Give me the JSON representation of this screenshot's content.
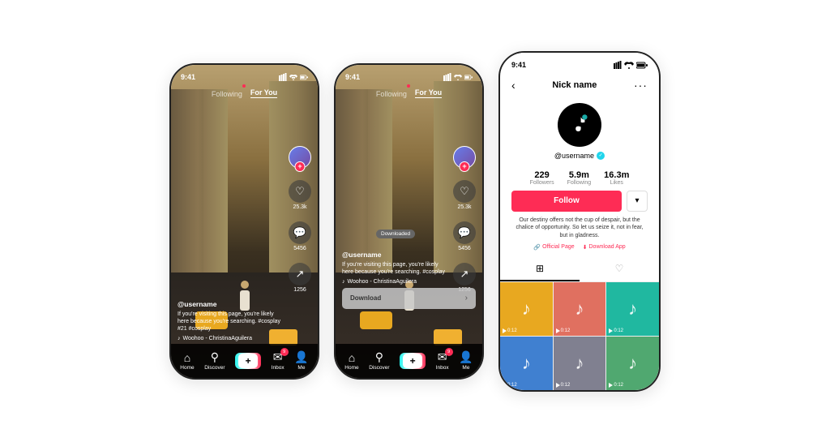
{
  "phones": {
    "phone1": {
      "time": "9:41",
      "tabs": {
        "following": "Following",
        "forYou": "For You"
      },
      "username": "@username",
      "caption": "If you're visiting this page, you're likely here because you're searching. #cosplay #21 #cosplay",
      "music": "♪ Woohoo - ChristinaAguilera",
      "likeCount": "25.3k",
      "commentCount": "5456",
      "shareCount": "1256",
      "nav": {
        "home": "Home",
        "discover": "Discover",
        "inbox": "Inbox",
        "me": "Me",
        "inboxBadge": "9"
      }
    },
    "phone2": {
      "time": "9:41",
      "tabs": {
        "following": "Following",
        "forYou": "For You"
      },
      "username": "@username",
      "caption": "If you're visiting this page, you're likely here because you're searching. #cosplay",
      "music": "♪ Woohoo - ChristinaAguilera",
      "likeCount": "25.3k",
      "commentCount": "5456",
      "shareCount": "1256",
      "downloadedBadge": "Downloaded",
      "downloadLabel": "Download",
      "nav": {
        "home": "Home",
        "discover": "Discover",
        "inbox": "Inbox",
        "me": "Me",
        "inboxBadge": "9"
      }
    },
    "phone3": {
      "time": "9:41",
      "nickname": "Nick name",
      "username": "@username",
      "stats": {
        "followers": "229",
        "followersLabel": "Followers",
        "following": "5.9m",
        "followingLabel": "Following",
        "likes": "16.3m",
        "likesLabel": "Likes"
      },
      "followBtn": "Follow",
      "bio": "Our destiny offers not the cup of despair, but the chalice of opportunity. So let us seize it, not in fear, but in gladness.",
      "officialPageLink": "Official Page",
      "downloadAppLink": "Download App",
      "gridItems": [
        {
          "duration": "0:12",
          "bg": "yellow"
        },
        {
          "duration": "0:12",
          "bg": "salmon"
        },
        {
          "duration": "0:12",
          "bg": "teal"
        },
        {
          "duration": "0:12",
          "bg": "blue"
        },
        {
          "duration": "0:12",
          "bg": "gray"
        },
        {
          "duration": "0:12",
          "bg": "green"
        }
      ]
    }
  }
}
